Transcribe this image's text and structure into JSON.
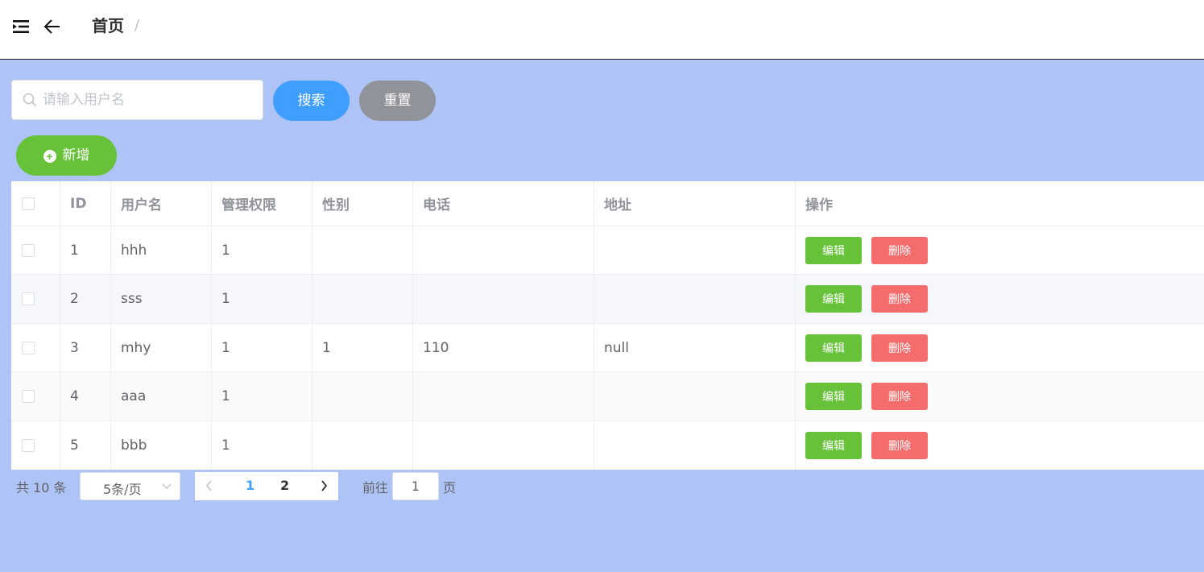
{
  "header": {
    "breadcrumb_title": "首页",
    "breadcrumb_separator": "/",
    "menu_icon": "menu-fold-icon",
    "back_icon": "arrow-left-icon"
  },
  "toolbar": {
    "search_placeholder": "请输入用户名",
    "search_value": "",
    "search_label": "搜索",
    "reset_label": "重置",
    "add_label": "新增"
  },
  "table": {
    "columns": [
      "ID",
      "用户名",
      "管理权限",
      "性别",
      "电话",
      "地址",
      "操作"
    ],
    "rows": [
      {
        "id": "1",
        "username": "hhh",
        "role": "1",
        "gender": "",
        "phone": "",
        "address": ""
      },
      {
        "id": "2",
        "username": "sss",
        "role": "1",
        "gender": "",
        "phone": "",
        "address": ""
      },
      {
        "id": "3",
        "username": "mhy",
        "role": "1",
        "gender": "1",
        "phone": "110",
        "address": "null"
      },
      {
        "id": "4",
        "username": "aaa",
        "role": "1",
        "gender": "",
        "phone": "",
        "address": ""
      },
      {
        "id": "5",
        "username": "bbb",
        "role": "1",
        "gender": "",
        "phone": "",
        "address": ""
      }
    ],
    "edit_label": "编辑",
    "delete_label": "删除"
  },
  "pagination": {
    "total_text": "共 10 条",
    "page_size": "5条/页",
    "pages": [
      "1",
      "2"
    ],
    "current_page": "1",
    "goto_label": "前往",
    "goto_value": "1",
    "goto_suffix": "页"
  },
  "colors": {
    "background": "#aec4f6",
    "primary": "#409eff",
    "success": "#67c23a",
    "danger": "#f56c6c",
    "info": "#909399"
  }
}
